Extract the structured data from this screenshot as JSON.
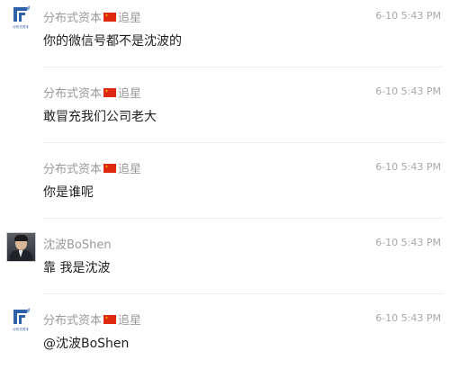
{
  "messages": [
    {
      "sender_name": "分布式资本",
      "sender_suffix": "追星",
      "avatar": "company-logo",
      "logo_caption": "分布式资本",
      "time": "6-10 5:43 PM",
      "content": "你的微信号都不是沈波的"
    },
    {
      "sender_name": "分布式资本",
      "sender_suffix": "追星",
      "avatar": "none",
      "time": "6-10 5:43 PM",
      "content": "敢冒充我们公司老大"
    },
    {
      "sender_name": "分布式资本",
      "sender_suffix": "追星",
      "avatar": "none",
      "time": "6-10 5:43 PM",
      "content": "你是谁呢"
    },
    {
      "sender_name": "沈波BoShen",
      "sender_suffix": "",
      "avatar": "person-photo",
      "time": "6-10 5:43 PM",
      "content": "靠 我是沈波"
    },
    {
      "sender_name": "分布式资本",
      "sender_suffix": "追星",
      "avatar": "company-logo",
      "logo_caption": "分布式资本",
      "time": "6-10 5:43 PM",
      "content": "@沈波BoShen"
    }
  ],
  "colors": {
    "brand_blue": "#2e61a8",
    "flag_red": "#de2910",
    "meta_gray": "#9a9a9a"
  },
  "icons": [
    "company-logo-icon",
    "china-flag-icon",
    "user-avatar"
  ]
}
